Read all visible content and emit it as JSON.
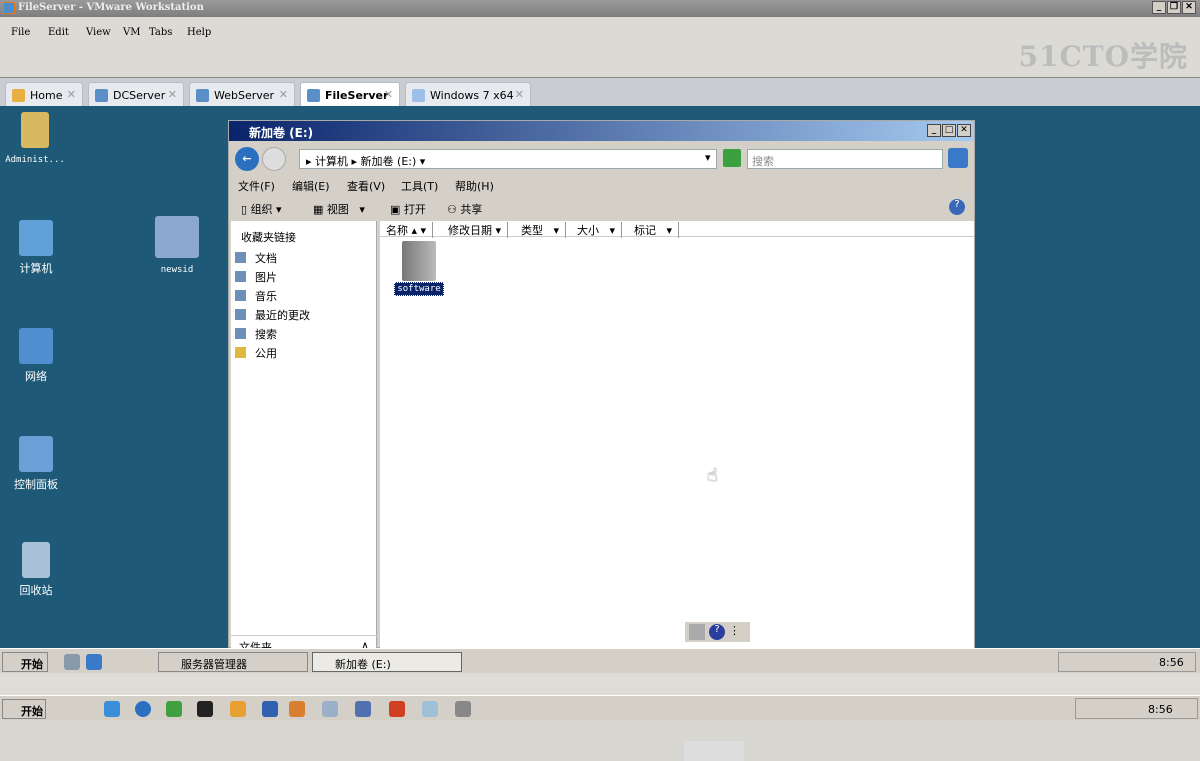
{
  "vmware": {
    "title": "FileServer - VMware Workstation",
    "menu": [
      "File",
      "Edit",
      "View",
      "VM",
      "Tabs",
      "Help"
    ],
    "logo": "51CTO学院",
    "tabs": [
      {
        "label": "Home"
      },
      {
        "label": "DCServer"
      },
      {
        "label": "WebServer"
      },
      {
        "label": "FileServer",
        "active": true
      },
      {
        "label": "Windows 7 x64"
      }
    ]
  },
  "desktop": {
    "icons": [
      "Administ...",
      "计算机",
      "newsid",
      "网络",
      "控制面板",
      "回收站"
    ]
  },
  "explorer": {
    "title": "新加卷 (E:)",
    "breadcrumb": [
      "计算机",
      "新加卷 (E:)"
    ],
    "search_placeholder": "搜索",
    "menu": [
      "文件(F)",
      "编辑(E)",
      "查看(V)",
      "工具(T)",
      "帮助(H)"
    ],
    "toolbar": [
      "组织",
      "视图",
      "打开",
      "共享"
    ],
    "favorites_title": "收藏夹链接",
    "favorites": [
      "文档",
      "图片",
      "音乐",
      "最近的更改",
      "搜索",
      "公用"
    ],
    "folders_label": "文件夹",
    "columns": [
      "名称",
      "修改日期",
      "类型",
      "大小",
      "标记"
    ],
    "items": [
      {
        "name": "software"
      }
    ]
  },
  "guest_taskbar": {
    "start": "开始",
    "buttons": [
      "服务器管理器",
      "新加卷 (E:)"
    ],
    "clock": "8:56"
  },
  "host_taskbar": {
    "start": "开始",
    "clock": "8:56"
  }
}
